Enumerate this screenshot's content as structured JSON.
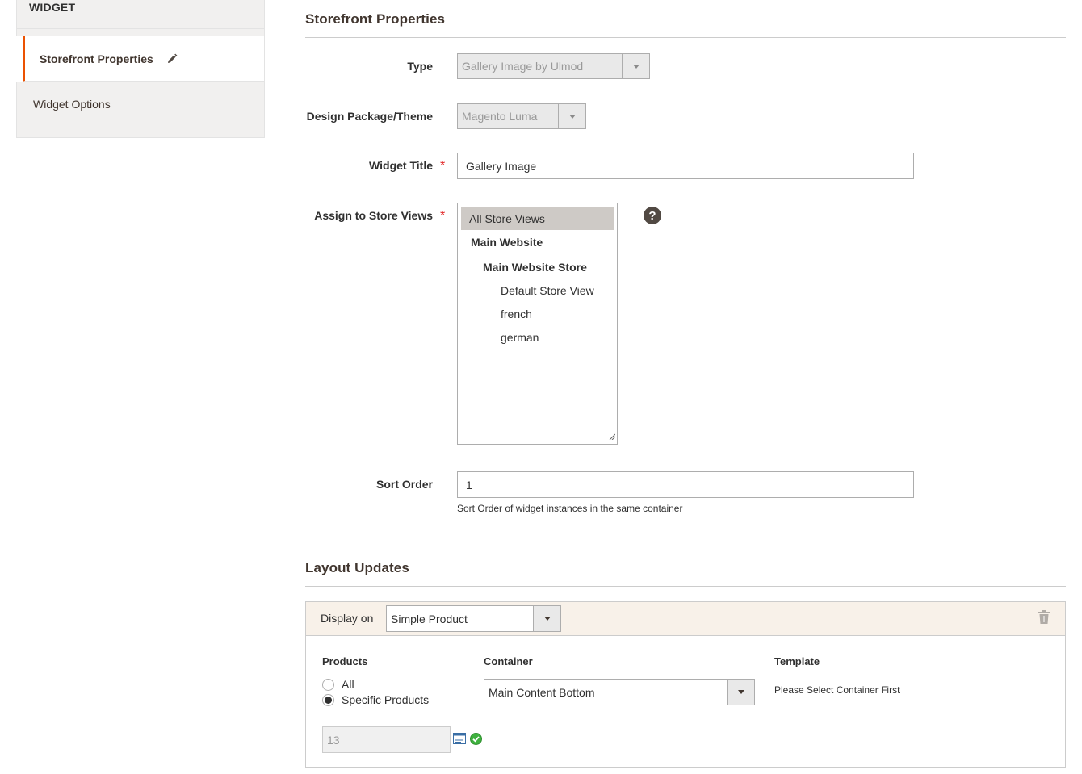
{
  "sidebar": {
    "heading": "WIDGET",
    "items": [
      {
        "label": "Storefront Properties",
        "active": true
      },
      {
        "label": "Widget Options",
        "active": false
      }
    ]
  },
  "storefront": {
    "title": "Storefront Properties",
    "type": {
      "label": "Type",
      "value": "Gallery Image by Ulmod"
    },
    "theme": {
      "label": "Design Package/Theme",
      "value": "Magento Luma"
    },
    "widget_title": {
      "label": "Widget Title",
      "value": "Gallery Image"
    },
    "store_views": {
      "label": "Assign to Store Views",
      "options": [
        {
          "text": "All Store Views",
          "kind": "selected"
        },
        {
          "text": "Main Website",
          "kind": "group"
        },
        {
          "text": "Main Website Store",
          "kind": "subgroup"
        },
        {
          "text": "Default Store View",
          "kind": "option"
        },
        {
          "text": "french",
          "kind": "option"
        },
        {
          "text": "german",
          "kind": "option"
        }
      ],
      "help": "?"
    },
    "sort_order": {
      "label": "Sort Order",
      "value": "1",
      "note": "Sort Order of widget instances in the same container"
    }
  },
  "layout_updates": {
    "title": "Layout Updates",
    "display_on_label": "Display on",
    "display_on_value": "Simple Product",
    "products_header": "Products",
    "radio_all": "All",
    "radio_specific": "Specific Products",
    "product_ids": "13",
    "container_header": "Container",
    "container_value": "Main Content Bottom",
    "template_header": "Template",
    "template_note": "Please Select Container First"
  },
  "colors": {
    "accent": "#eb5202",
    "required": "#e22626",
    "panel_head": "#f8f1e9"
  }
}
